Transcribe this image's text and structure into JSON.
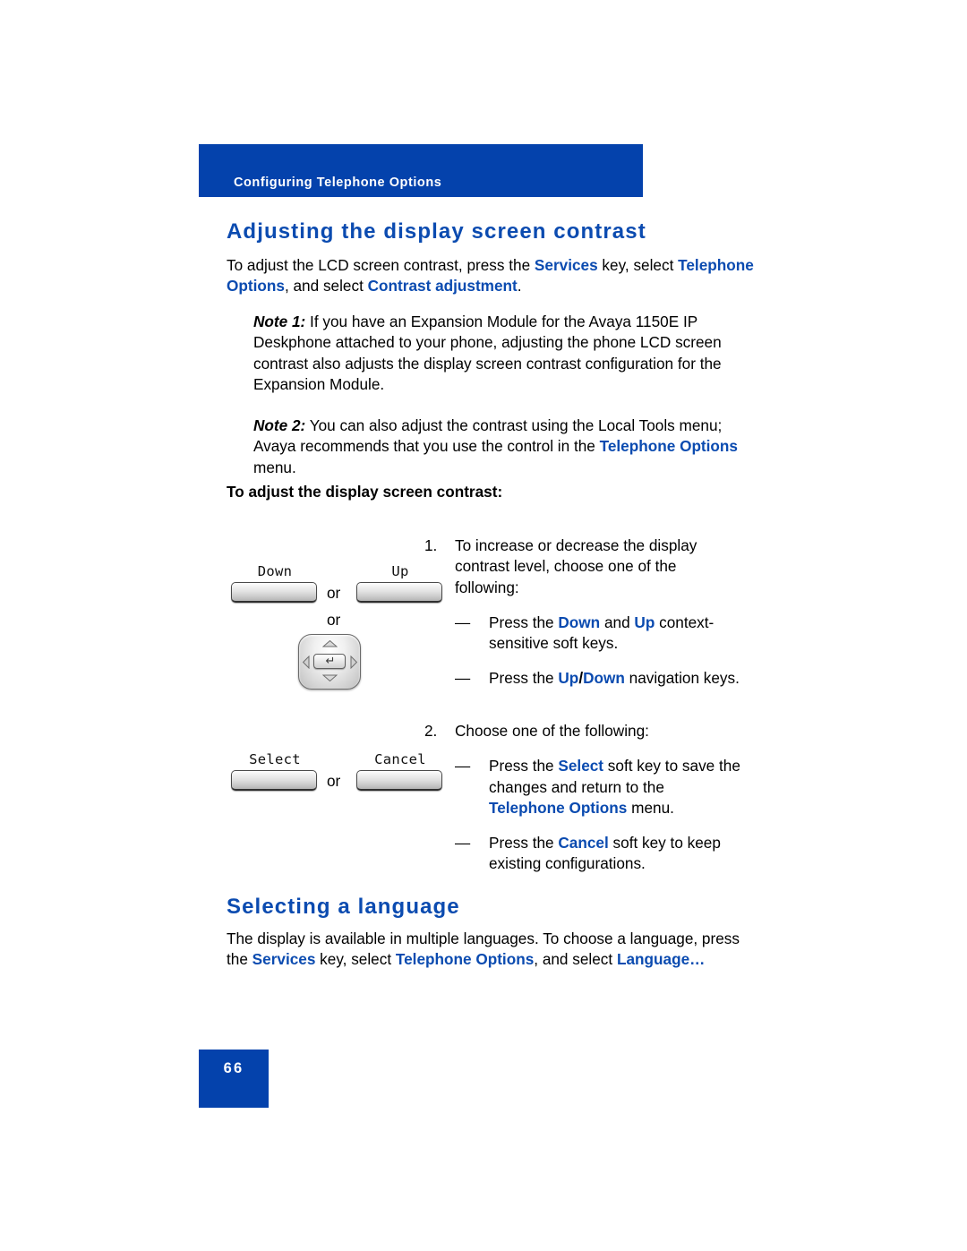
{
  "document": {
    "running_header": "Configuring Telephone Options",
    "page_number": "66"
  },
  "colors": {
    "brand_blue": "#0442ac",
    "heading_blue": "#0b4bb0",
    "body_black": "#000000",
    "page_background": "#ffffff"
  },
  "sections": [
    {
      "id": "contrast",
      "heading": "Adjusting the display screen contrast"
    },
    {
      "id": "language",
      "heading": "Selecting a language"
    }
  ],
  "contrast_section": {
    "heading": "Adjusting the display screen contrast",
    "intro": {
      "p1": "To adjust the LCD screen contrast, press the ",
      "term_services": "Services",
      "p2": " key, select ",
      "term_telephone_options": "Telephone Options",
      "p3": ", and select ",
      "term_contrast_adjustment": "Contrast adjustment",
      "p4": "."
    },
    "note_1": {
      "label": "Note 1:",
      "text": " If you have an Expansion Module for the Avaya 1150E IP Deskphone attached to your phone, adjusting the phone LCD screen contrast also adjusts the display screen contrast configuration for the Expansion Module."
    },
    "note_2": {
      "label": "Note 2:",
      "text_a": " You can also adjust the contrast using the Local Tools menu; Avaya recommends that you use the control in the ",
      "term_telephone_options": "Telephone Options",
      "text_b": " menu."
    },
    "subheading": "To adjust the display screen contrast:",
    "steps": [
      {
        "number": "1.",
        "lead": "To increase or decrease the display contrast level, choose one of the following:",
        "bullets": [
          {
            "dash": "—",
            "a": "Press the ",
            "term1": "Down",
            "b": " and ",
            "term2": "Up",
            "c": " context-sensitive soft keys."
          },
          {
            "dash": "—",
            "a": "Press the ",
            "term1": "Up",
            "sep": "/",
            "term2": "Down",
            "c": " navigation keys."
          }
        ]
      },
      {
        "number": "2.",
        "lead": "Choose one of the following:",
        "bullets": [
          {
            "dash": "—",
            "a": "Press the ",
            "term1": "Select",
            "b": " soft key to save the changes and return to the ",
            "term2": "Telephone Options",
            "c": " menu."
          },
          {
            "dash": "—",
            "a": "Press the ",
            "term1": "Cancel",
            "b": " soft key to keep existing configurations.",
            "term2": "",
            "c": ""
          }
        ]
      }
    ],
    "illustration_updown": {
      "left_key_label": "Down",
      "right_key_label": "Up",
      "or_between": "or",
      "or_below": "or",
      "nav_cluster": {
        "up_icon": "chevron-up-icon",
        "down_icon": "chevron-down-icon",
        "left_icon": "chevron-left-icon",
        "right_icon": "chevron-right-icon",
        "enter_glyph": "↵"
      }
    },
    "illustration_selectcancel": {
      "left_key_label": "Select",
      "right_key_label": "Cancel",
      "or_between": "or"
    }
  },
  "language_section": {
    "heading": "Selecting a language",
    "paragraph": {
      "p1": "The display is available in multiple languages. To choose a language, press the ",
      "term_services": "Services",
      "p2": " key, select ",
      "term_telephone_options": "Telephone Options",
      "p3": ", and select ",
      "term_language": "Language…"
    }
  }
}
